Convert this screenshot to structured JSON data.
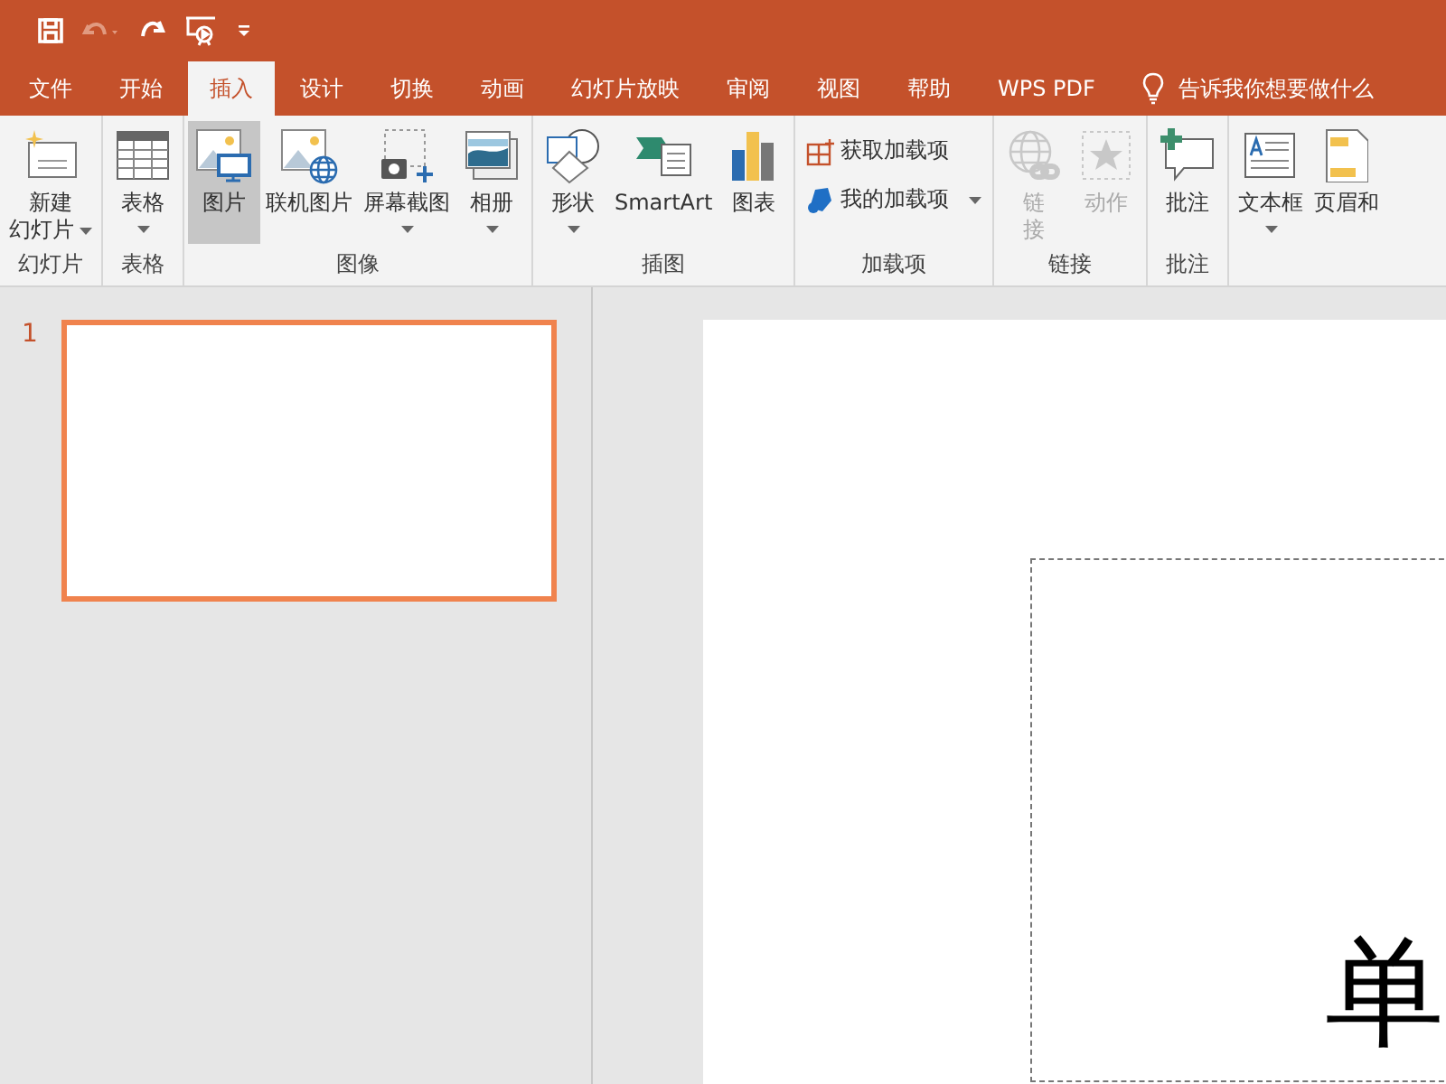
{
  "quick_access": [
    {
      "kind": "save",
      "disabled": false
    },
    {
      "kind": "undo",
      "disabled": true
    },
    {
      "kind": "redo",
      "disabled": false
    },
    {
      "kind": "present",
      "disabled": false
    },
    {
      "kind": "customize",
      "disabled": false
    }
  ],
  "tabs": [
    {
      "label": "文件",
      "selected": false
    },
    {
      "label": "开始",
      "selected": false
    },
    {
      "label": "插入",
      "selected": true
    },
    {
      "label": "设计",
      "selected": false
    },
    {
      "label": "切换",
      "selected": false
    },
    {
      "label": "动画",
      "selected": false
    },
    {
      "label": "幻灯片放映",
      "selected": false
    },
    {
      "label": "审阅",
      "selected": false
    },
    {
      "label": "视图",
      "selected": false
    },
    {
      "label": "帮助",
      "selected": false
    },
    {
      "label": "WPS PDF",
      "selected": false
    }
  ],
  "tell_me": "告诉我你想要做什么",
  "ribbon_groups": [
    {
      "label": "幻灯片",
      "buttons": [
        {
          "kind": "new-slide",
          "lines": [
            "新建",
            "幻灯片"
          ],
          "dropdown": true,
          "pressed": false,
          "disabled": false
        }
      ]
    },
    {
      "label": "表格",
      "buttons": [
        {
          "kind": "table",
          "lines": [
            "表格"
          ],
          "dropdown": true,
          "pressed": false,
          "disabled": false
        }
      ]
    },
    {
      "label": "图像",
      "buttons": [
        {
          "kind": "picture",
          "lines": [
            "图片"
          ],
          "dropdown": false,
          "pressed": true,
          "disabled": false
        },
        {
          "kind": "online-picture",
          "lines": [
            "联机图片"
          ],
          "dropdown": false,
          "pressed": false,
          "disabled": false
        },
        {
          "kind": "screenshot",
          "lines": [
            "屏幕截图"
          ],
          "dropdown": true,
          "pressed": false,
          "disabled": false
        },
        {
          "kind": "album",
          "lines": [
            "相册"
          ],
          "dropdown": true,
          "pressed": false,
          "disabled": false
        }
      ]
    },
    {
      "label": "插图",
      "buttons": [
        {
          "kind": "shapes",
          "lines": [
            "形状"
          ],
          "dropdown": true,
          "pressed": false,
          "disabled": false
        },
        {
          "kind": "smartart",
          "lines": [
            "SmartArt"
          ],
          "dropdown": false,
          "pressed": false,
          "disabled": false
        },
        {
          "kind": "chart",
          "lines": [
            "图表"
          ],
          "dropdown": false,
          "pressed": false,
          "disabled": false
        }
      ]
    },
    {
      "label": "加载项",
      "small_buttons": [
        {
          "kind": "get-addins",
          "label": "获取加载项",
          "dropdown": false
        },
        {
          "kind": "my-addins",
          "label": "我的加载项",
          "dropdown": true
        }
      ]
    },
    {
      "label": "链接",
      "buttons": [
        {
          "kind": "link",
          "lines": [
            "链",
            "接"
          ],
          "dropdown": false,
          "pressed": false,
          "disabled": true
        },
        {
          "kind": "action",
          "lines": [
            "动作"
          ],
          "dropdown": false,
          "pressed": false,
          "disabled": true
        }
      ]
    },
    {
      "label": "批注",
      "buttons": [
        {
          "kind": "comment",
          "lines": [
            "批注"
          ],
          "dropdown": false,
          "pressed": false,
          "disabled": false
        }
      ]
    },
    {
      "buttons": [
        {
          "kind": "textbox",
          "lines": [
            "文本框"
          ],
          "dropdown": true,
          "pressed": false,
          "disabled": false
        },
        {
          "kind": "header",
          "lines": [
            "页眉和"
          ],
          "dropdown": false,
          "pressed": false,
          "disabled": false
        }
      ]
    }
  ],
  "slides": [
    {
      "number": "1",
      "selected": true
    }
  ],
  "slide_text": "单"
}
